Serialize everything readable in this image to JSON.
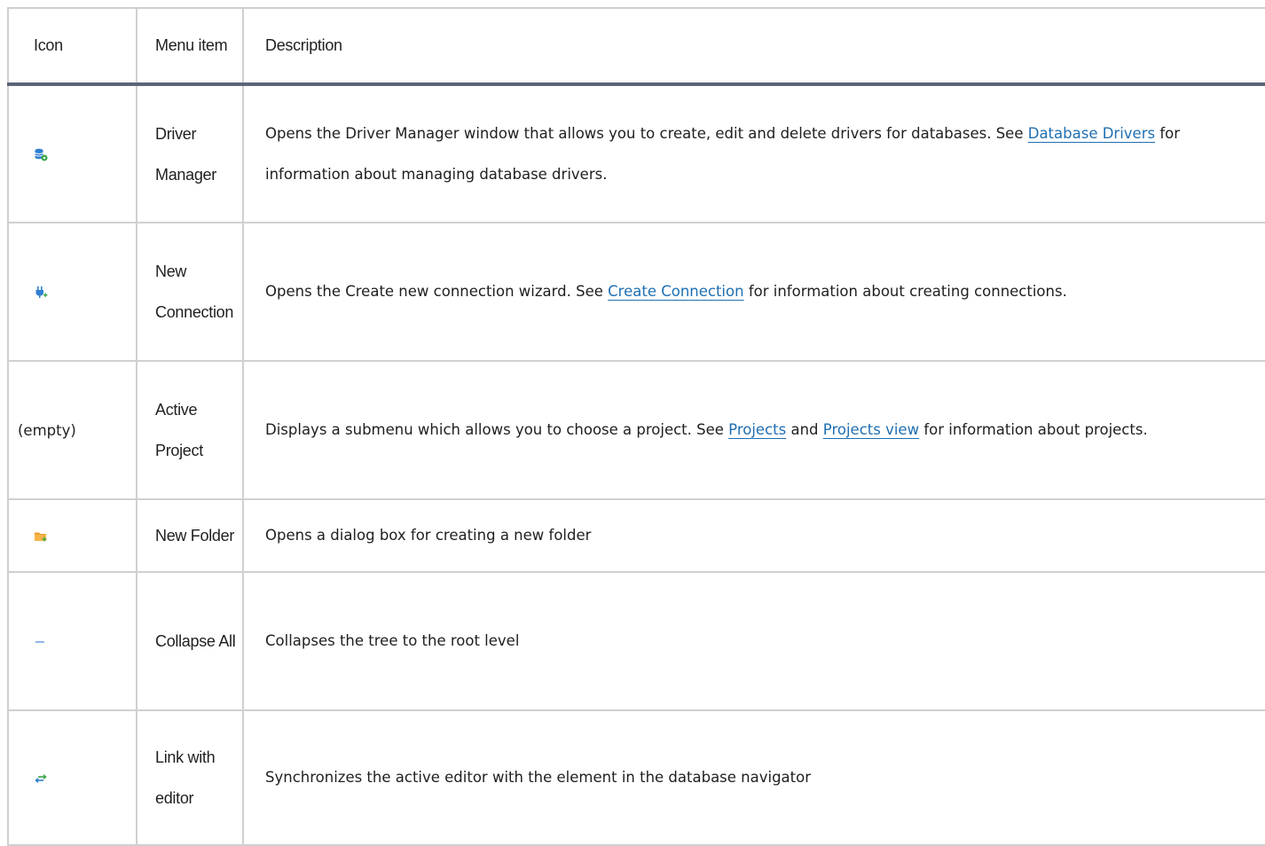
{
  "table": {
    "headers": {
      "icon": "Icon",
      "item": "Menu item",
      "description": "Description"
    },
    "rows": [
      {
        "icon": "driver-manager-icon",
        "item": "Driver Manager",
        "desc": {
          "a": "Opens the Driver Manager window that allows you to create, edit and delete drivers for databases. See ",
          "link1": "Database Drivers",
          "b": " for information about managing database drivers."
        }
      },
      {
        "icon": "new-connection-icon",
        "item": "New Connection",
        "desc": {
          "a": "Opens the Create new connection wizard. See ",
          "link1": "Create Connection",
          "b": " for information about creating connections."
        }
      },
      {
        "icon_text": "(empty)",
        "item": "Active Project",
        "desc": {
          "a": "Displays a submenu which allows you to choose a project. See ",
          "link1": "Projects",
          "b": " and ",
          "link2": "Projects view",
          "c": " for information about projects."
        }
      },
      {
        "icon": "new-folder-icon",
        "item": "New Folder",
        "desc": {
          "a": "Opens a dialog box for creating a new folder"
        }
      },
      {
        "icon": "collapse-all-icon",
        "item": "Collapse All",
        "desc": {
          "a": "Collapses the tree to the root level"
        }
      },
      {
        "icon": "link-with-editor-icon",
        "item": "Link with editor",
        "desc": {
          "a": "Synchronizes the active editor with the element in the database navigator"
        }
      }
    ]
  },
  "colors": {
    "link": "#1f6fb2",
    "header_rule": "#5b6577",
    "grid": "#d0d0d0"
  }
}
